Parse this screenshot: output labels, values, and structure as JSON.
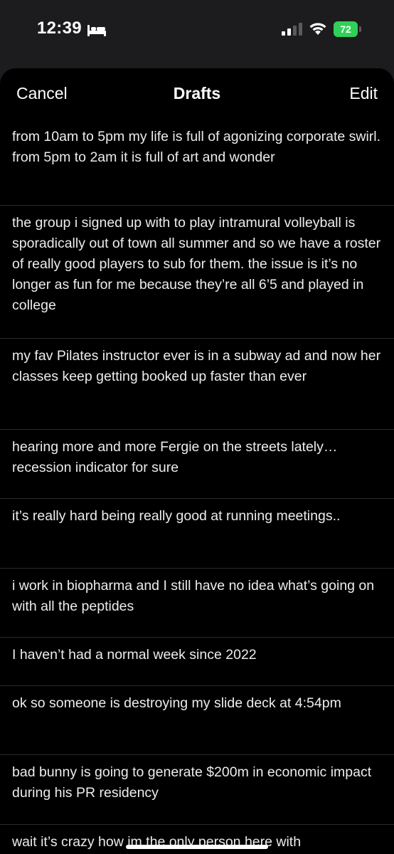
{
  "status_bar": {
    "time": "12:39",
    "battery_level": "72",
    "battery_charging": true,
    "focus_mode_icon": "bed-icon",
    "signal_icon": "cellular-signal-icon",
    "wifi_icon": "wifi-icon",
    "battery_color": "#30d158"
  },
  "nav": {
    "cancel_label": "Cancel",
    "title": "Drafts",
    "edit_label": "Edit"
  },
  "drafts": [
    {
      "text": "from 10am to 5pm my life is full of agonizing corporate swirl. from 5pm to 2am it is full of art and wonder"
    },
    {
      "text": "the group i signed up with to play intramural volleyball is sporadically out of town all summer and so we have a roster of really good players to sub for them. the issue is it’s no longer as fun for me because they’re all 6’5 and played in college"
    },
    {
      "text": "my fav Pilates instructor ever is in a subway ad and now her classes keep getting booked up faster than ever"
    },
    {
      "text": "hearing more and more Fergie on the streets lately… recession indicator for sure"
    },
    {
      "text": "it’s really hard being really good at running meetings.."
    },
    {
      "text": "i work in biopharma and I still have no idea what’s going on with all the peptides"
    },
    {
      "text": "I haven’t had a normal week since 2022"
    },
    {
      "text": "ok so someone is destroying my slide deck at 4:54pm"
    },
    {
      "text": "bad bunny is going to generate $200m in economic impact during his PR residency"
    },
    {
      "text": "wait it’s crazy how im the only person here with"
    }
  ],
  "colors": {
    "sheet_background": "#000000",
    "status_background": "#1c1c1e",
    "separator": "#2a2a2c",
    "text": "#ececec"
  }
}
